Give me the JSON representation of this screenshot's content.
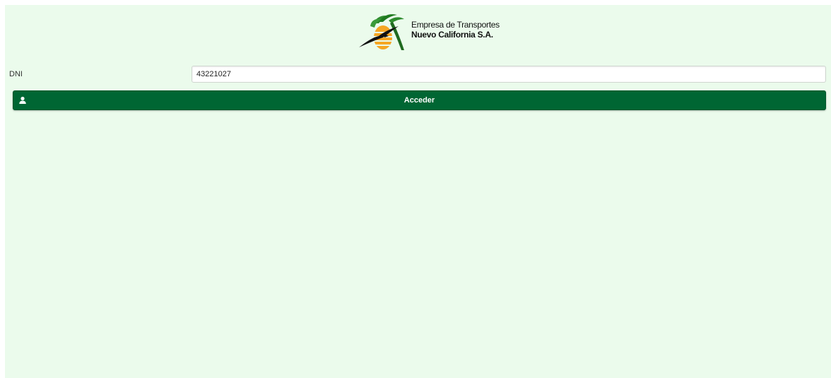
{
  "header": {
    "company_line1": "Empresa de Transportes",
    "company_line2": "Nuevo California S.A."
  },
  "form": {
    "dni_label": "DNI",
    "dni_value": "43221027",
    "submit_label": "Acceder",
    "submit_icon": "user-icon"
  },
  "colors": {
    "background": "#ebfbec",
    "button": "#006633"
  }
}
